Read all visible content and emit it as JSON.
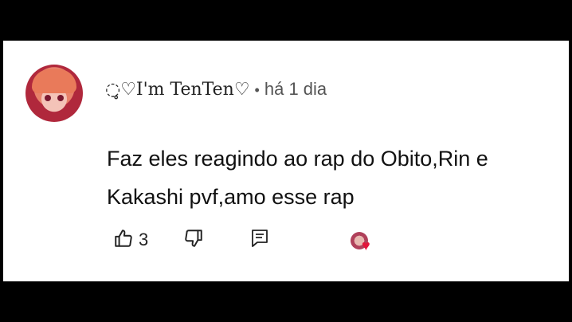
{
  "comment": {
    "author": "◌̥♡I'm TenTen♡",
    "separator": "•",
    "timestamp": "há 1 dia",
    "text_line1": "Faz eles reagindo ao rap do Obito,Rin e",
    "text_line2": "Kakashi pvf,amo esse rap",
    "like_count": "3",
    "icons": {
      "like": "thumbs-up-icon",
      "dislike": "thumbs-down-icon",
      "reply": "reply-comment-icon",
      "creator_heart": "creator-heart-icon"
    },
    "colors": {
      "heart": "#e3153a",
      "background": "#ffffff",
      "letterbox": "#000000"
    }
  }
}
